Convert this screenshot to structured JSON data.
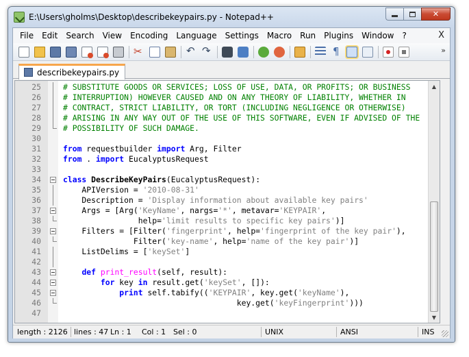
{
  "window": {
    "title": "E:\\Users\\gholms\\Desktop\\describekeypairs.py - Notepad++",
    "close_glyph": "✕"
  },
  "menu": {
    "items": [
      "File",
      "Edit",
      "Search",
      "View",
      "Encoding",
      "Language",
      "Settings",
      "Macro",
      "Run",
      "Plugins",
      "Window",
      "?"
    ],
    "close_label": "X"
  },
  "toolbar": {
    "icons": [
      "new-file-icon",
      "open-file-icon",
      "save-icon",
      "save-all-icon",
      "close-icon",
      "close-all-icon",
      "print-icon",
      "cut-icon",
      "copy-icon",
      "paste-icon",
      "undo-icon",
      "redo-icon",
      "find-icon",
      "replace-icon",
      "zoom-in-icon",
      "zoom-out-icon",
      "sync-scroll-icon",
      "word-wrap-icon",
      "show-all-chars-icon",
      "indent-guide-icon",
      "user-language-icon",
      "record-macro-icon",
      "stop-macro-icon"
    ],
    "more_glyph": "»"
  },
  "tab": {
    "label": "describekeypairs.py"
  },
  "editor": {
    "lines": [
      {
        "n": "25",
        "fold": "line",
        "segs": [
          [
            "comment",
            "# SUBSTITUTE GOODS OR SERVICES; LOSS OF USE, DATA, OR PROFITS; OR BUSINESS"
          ]
        ]
      },
      {
        "n": "26",
        "fold": "line",
        "segs": [
          [
            "comment",
            "# INTERRUPTION) HOWEVER CAUSED AND ON ANY THEORY OF LIABILITY, WHETHER IN"
          ]
        ]
      },
      {
        "n": "27",
        "fold": "line",
        "segs": [
          [
            "comment",
            "# CONTRACT, STRICT LIABILITY, OR TORT (INCLUDING NEGLIGENCE OR OTHERWISE)"
          ]
        ]
      },
      {
        "n": "28",
        "fold": "line",
        "segs": [
          [
            "comment",
            "# ARISING IN ANY WAY OUT OF THE USE OF THIS SOFTWARE, EVEN IF ADVISED OF THE"
          ]
        ]
      },
      {
        "n": "29",
        "fold": "end",
        "segs": [
          [
            "comment",
            "# POSSIBILITY OF SUCH DAMAGE."
          ]
        ]
      },
      {
        "n": "30",
        "fold": "",
        "segs": []
      },
      {
        "n": "31",
        "fold": "",
        "segs": [
          [
            "kw",
            "from"
          ],
          [
            "txt",
            " requestbuilder "
          ],
          [
            "kw",
            "import"
          ],
          [
            "txt",
            " Arg, Filter"
          ]
        ]
      },
      {
        "n": "32",
        "fold": "",
        "segs": [
          [
            "kw",
            "from"
          ],
          [
            "txt",
            " . "
          ],
          [
            "kw",
            "import"
          ],
          [
            "txt",
            " EucalyptusRequest"
          ]
        ]
      },
      {
        "n": "33",
        "fold": "",
        "segs": []
      },
      {
        "n": "34",
        "fold": "box",
        "segs": [
          [
            "kw",
            "class"
          ],
          [
            "txt",
            " "
          ],
          [
            "cls",
            "DescribeKeyPairs"
          ],
          [
            "txt",
            "(EucalyptusRequest):"
          ]
        ]
      },
      {
        "n": "35",
        "fold": "line",
        "segs": [
          [
            "txt",
            "    APIVersion = "
          ],
          [
            "str",
            "'2010-08-31'"
          ]
        ]
      },
      {
        "n": "36",
        "fold": "line",
        "segs": [
          [
            "txt",
            "    Description = "
          ],
          [
            "str",
            "'Display information about available key pairs'"
          ]
        ]
      },
      {
        "n": "37",
        "fold": "box",
        "segs": [
          [
            "txt",
            "    Args = [Arg("
          ],
          [
            "str",
            "'KeyName'"
          ],
          [
            "txt",
            ", nargs="
          ],
          [
            "str",
            "'*'"
          ],
          [
            "txt",
            ", metavar="
          ],
          [
            "str",
            "'KEYPAIR'"
          ],
          [
            "txt",
            ","
          ]
        ]
      },
      {
        "n": "38",
        "fold": "end",
        "segs": [
          [
            "txt",
            "                help="
          ],
          [
            "str",
            "'limit results to specific key pairs'"
          ],
          [
            "txt",
            ")]"
          ]
        ]
      },
      {
        "n": "39",
        "fold": "box",
        "segs": [
          [
            "txt",
            "    Filters = [Filter("
          ],
          [
            "str",
            "'fingerprint'"
          ],
          [
            "txt",
            ", help="
          ],
          [
            "str",
            "'fingerprint of the key pair'"
          ],
          [
            "txt",
            "),"
          ]
        ]
      },
      {
        "n": "40",
        "fold": "end",
        "segs": [
          [
            "txt",
            "               Filter("
          ],
          [
            "str",
            "'key-name'"
          ],
          [
            "txt",
            ", help="
          ],
          [
            "str",
            "'name of the key pair'"
          ],
          [
            "txt",
            ")]"
          ]
        ]
      },
      {
        "n": "41",
        "fold": "line",
        "segs": [
          [
            "txt",
            "    ListDelims = ["
          ],
          [
            "str",
            "'keySet'"
          ],
          [
            "txt",
            "]"
          ]
        ]
      },
      {
        "n": "42",
        "fold": "line",
        "segs": []
      },
      {
        "n": "43",
        "fold": "box",
        "segs": [
          [
            "txt",
            "    "
          ],
          [
            "kw",
            "def"
          ],
          [
            "txt",
            " "
          ],
          [
            "def",
            "print_result"
          ],
          [
            "txt",
            "(self, result):"
          ]
        ]
      },
      {
        "n": "44",
        "fold": "box",
        "segs": [
          [
            "txt",
            "        "
          ],
          [
            "kw",
            "for"
          ],
          [
            "txt",
            " key "
          ],
          [
            "kw",
            "in"
          ],
          [
            "txt",
            " result.get("
          ],
          [
            "str",
            "'keySet'"
          ],
          [
            "txt",
            ", []):"
          ]
        ]
      },
      {
        "n": "45",
        "fold": "box",
        "segs": [
          [
            "txt",
            "            "
          ],
          [
            "kw",
            "print"
          ],
          [
            "txt",
            " self.tabify(("
          ],
          [
            "str",
            "'KEYPAIR'"
          ],
          [
            "txt",
            ", key.get("
          ],
          [
            "str",
            "'keyName'"
          ],
          [
            "txt",
            "),"
          ]
        ]
      },
      {
        "n": "46",
        "fold": "end",
        "segs": [
          [
            "txt",
            "                                     key.get("
          ],
          [
            "str",
            "'keyFingerprint'"
          ],
          [
            "txt",
            ")))"
          ]
        ]
      },
      {
        "n": "47",
        "fold": "",
        "segs": []
      }
    ]
  },
  "scrollbar": {
    "up_glyph": "▲",
    "down_glyph": "▼"
  },
  "status": {
    "length": "length : 2126",
    "lines": "lines : 47",
    "ln": "Ln : 1",
    "col": "Col : 1",
    "sel": "Sel : 0",
    "eol": "UNIX",
    "encoding": "ANSI",
    "mode": "INS"
  }
}
